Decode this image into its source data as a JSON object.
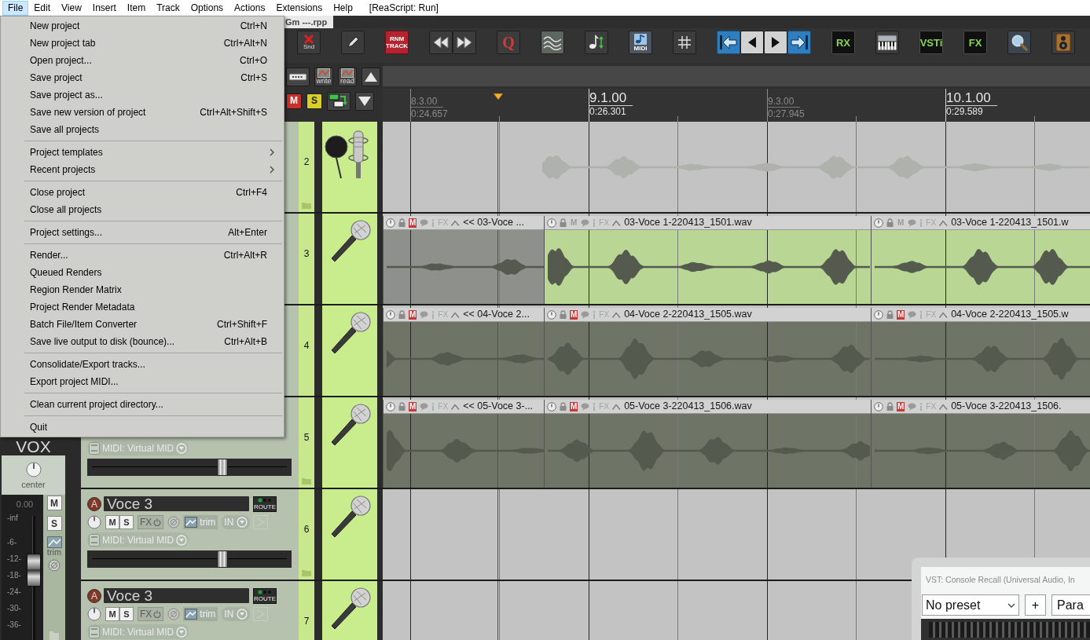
{
  "menubar": [
    {
      "label": "File",
      "selected": true
    },
    {
      "label": "Edit",
      "selected": false
    },
    {
      "label": "View",
      "selected": false
    },
    {
      "label": "Insert",
      "selected": false
    },
    {
      "label": "Item",
      "selected": false
    },
    {
      "label": "Track",
      "selected": false
    },
    {
      "label": "Options",
      "selected": false
    },
    {
      "label": "Actions",
      "selected": false
    },
    {
      "label": "Extensions",
      "selected": false
    },
    {
      "label": "Help",
      "selected": false
    }
  ],
  "menubar_status": "[ReaScript: Run]",
  "project_tab": {
    "title": "Gm ---.rpp"
  },
  "toolbar": [
    [
      {
        "kind": "snap",
        "label": "Snd"
      }
    ],
    [
      {
        "kind": "marker"
      }
    ],
    [
      {
        "kind": "tile",
        "label": "RNM TRACK"
      }
    ],
    [
      {
        "kind": "rewind"
      },
      {
        "kind": "fast-forward"
      }
    ],
    [
      {
        "kind": "letter",
        "label": "Q"
      }
    ],
    [
      {
        "kind": "envelope"
      }
    ],
    [
      {
        "kind": "note-arrows"
      }
    ],
    [
      {
        "kind": "midi",
        "label": "MIDI"
      }
    ],
    [
      {
        "kind": "grid"
      }
    ],
    [
      {
        "kind": "go-start"
      },
      {
        "kind": "previous"
      },
      {
        "kind": "next"
      },
      {
        "kind": "go-end"
      }
    ],
    [
      {
        "kind": "console-tile",
        "label": "RX"
      }
    ],
    [
      {
        "kind": "keyboard"
      }
    ],
    [
      {
        "kind": "console-tile",
        "label": "VSTi"
      }
    ],
    [
      {
        "kind": "console-tile",
        "label": "FX"
      }
    ],
    [
      {
        "kind": "search"
      }
    ],
    [
      {
        "kind": "speaker"
      }
    ]
  ],
  "track_tools": [
    [
      {
        "kind": "razor"
      },
      {
        "kind": "automation",
        "label": "write"
      },
      {
        "kind": "automation",
        "label": "read"
      },
      {
        "kind": "scroll-up"
      }
    ],
    [
      {
        "kind": "mute",
        "label": "M"
      },
      {
        "kind": "solo",
        "label": "S"
      },
      {
        "kind": "routing"
      },
      {
        "kind": "scroll-down"
      }
    ]
  ],
  "ruler": [
    {
      "bar": "8.3.00",
      "time": "0:24.657",
      "major": false
    },
    {
      "bar": "9.1.00",
      "time": "0:26.301",
      "major": true
    },
    {
      "bar": "9.3.00",
      "time": "0:27.945",
      "major": false
    },
    {
      "bar": "10.1.00",
      "time": "0:29.589",
      "major": true
    }
  ],
  "mixer_strip": {
    "name": "VOX",
    "pan_label": "center",
    "volume": "0.00",
    "scale": [
      "-inf",
      "-6-",
      "-12-",
      "-18-",
      "-24-",
      "-30-",
      "-36-"
    ],
    "mute_label": "M",
    "solo_label": "S",
    "trim_label": "trim",
    "fader": {
      "level": 0.59
    }
  },
  "tracks": [
    {
      "number": "2",
      "folder_icon": true,
      "kind": "folder"
    },
    {
      "number": "3",
      "folder_icon": false,
      "kind": "audio",
      "items": [
        {
          "title": "<< 03-Voce ...",
          "muted": true,
          "mute_label": "M",
          "fx_label": "FX",
          "color": "#8e918b"
        },
        {
          "title": "03-Voce 1-220413_1501.wav",
          "muted": false,
          "mute_label": "M",
          "fx_label": "FX",
          "color": "#b9d694"
        },
        {
          "title": "03-Voce 1-220413_1501.w",
          "muted": false,
          "mute_label": "M",
          "fx_label": "FX",
          "color": "#b9d694"
        }
      ]
    },
    {
      "number": "4",
      "folder_icon": false,
      "kind": "audio",
      "items": [
        {
          "title": "<< 04-Voce 2...",
          "muted": true,
          "mute_label": "M",
          "fx_label": "FX",
          "color": "#6e7466"
        },
        {
          "title": "04-Voce 2-220413_1505.wav",
          "muted": true,
          "mute_label": "M",
          "fx_label": "FX",
          "color": "#6e7466"
        },
        {
          "title": "04-Voce 2-220413_1505.w",
          "muted": true,
          "mute_label": "M",
          "fx_label": "FX",
          "color": "#6e7466"
        }
      ]
    },
    {
      "number": "5",
      "folder_icon": true,
      "kind": "audio",
      "midi_input": "MIDI: Virtual MID",
      "fader": {
        "level": 0.67
      },
      "items": [
        {
          "title": "<< 05-Voce 3-...",
          "muted": true,
          "mute_label": "M",
          "fx_label": "FX",
          "color": "#6e7466"
        },
        {
          "title": "05-Voce 3-220413_1506.wav",
          "muted": true,
          "mute_label": "M",
          "fx_label": "FX",
          "color": "#6e7466"
        },
        {
          "title": "05-Voce 3-220413_1506.",
          "muted": true,
          "mute_label": "M",
          "fx_label": "FX",
          "color": "#6e7466"
        }
      ]
    },
    {
      "number": "6",
      "folder_icon": true,
      "kind": "empty",
      "name": "Voce 3",
      "arm_label": "A",
      "route_label": "ROUTE",
      "mute_label": "M",
      "solo_label": "S",
      "fx_label": "FX",
      "trim_label": "trim",
      "input_label": "IN",
      "midi_input": "MIDI: Virtual MID",
      "fader": {
        "level": 0.67
      }
    },
    {
      "number": "7",
      "folder_icon": false,
      "kind": "empty",
      "name": "Voce 3",
      "arm_label": "A",
      "route_label": "ROUTE",
      "mute_label": "M",
      "solo_label": "S",
      "fx_label": "FX",
      "trim_label": "trim",
      "input_label": "IN",
      "midi_input": "MIDI: Virtual MID"
    }
  ],
  "file_menu": {
    "items": [
      {
        "kind": "command",
        "label": "New project",
        "shortcut": "Ctrl+N"
      },
      {
        "kind": "command",
        "label": "New project tab",
        "shortcut": "Ctrl+Alt+N"
      },
      {
        "kind": "command",
        "label": "Open project...",
        "shortcut": "Ctrl+O"
      },
      {
        "kind": "command",
        "label": "Save project",
        "shortcut": "Ctrl+S"
      },
      {
        "kind": "command",
        "label": "Save project as..."
      },
      {
        "kind": "command",
        "label": "Save new version of project",
        "shortcut": "Ctrl+Alt+Shift+S"
      },
      {
        "kind": "command",
        "label": "Save all projects"
      },
      {
        "kind": "separator"
      },
      {
        "kind": "submenu",
        "label": "Project templates"
      },
      {
        "kind": "submenu",
        "label": "Recent projects"
      },
      {
        "kind": "separator"
      },
      {
        "kind": "command",
        "label": "Close project",
        "shortcut": "Ctrl+F4"
      },
      {
        "kind": "command",
        "label": "Close all projects"
      },
      {
        "kind": "separator"
      },
      {
        "kind": "command",
        "label": "Project settings...",
        "shortcut": "Alt+Enter"
      },
      {
        "kind": "separator"
      },
      {
        "kind": "command",
        "label": "Render...",
        "shortcut": "Ctrl+Alt+R"
      },
      {
        "kind": "command",
        "label": "Queued Renders"
      },
      {
        "kind": "command",
        "label": "Region Render Matrix"
      },
      {
        "kind": "command",
        "label": "Project Render Metadata"
      },
      {
        "kind": "command",
        "label": "Batch File/Item Converter",
        "shortcut": "Ctrl+Shift+F"
      },
      {
        "kind": "command",
        "label": "Save live output to disk (bounce)...",
        "shortcut": "Ctrl+Alt+B"
      },
      {
        "kind": "separator"
      },
      {
        "kind": "command",
        "label": "Consolidate/Export tracks..."
      },
      {
        "kind": "command",
        "label": "Export project MIDI..."
      },
      {
        "kind": "separator"
      },
      {
        "kind": "command",
        "label": "Clean current project directory..."
      },
      {
        "kind": "separator"
      },
      {
        "kind": "command",
        "label": "Quit"
      }
    ]
  },
  "fx_window": {
    "title": "VST: Console Recall (Universal Audio, In",
    "preset": "No preset",
    "add_label": "+",
    "param_label": "Para"
  }
}
